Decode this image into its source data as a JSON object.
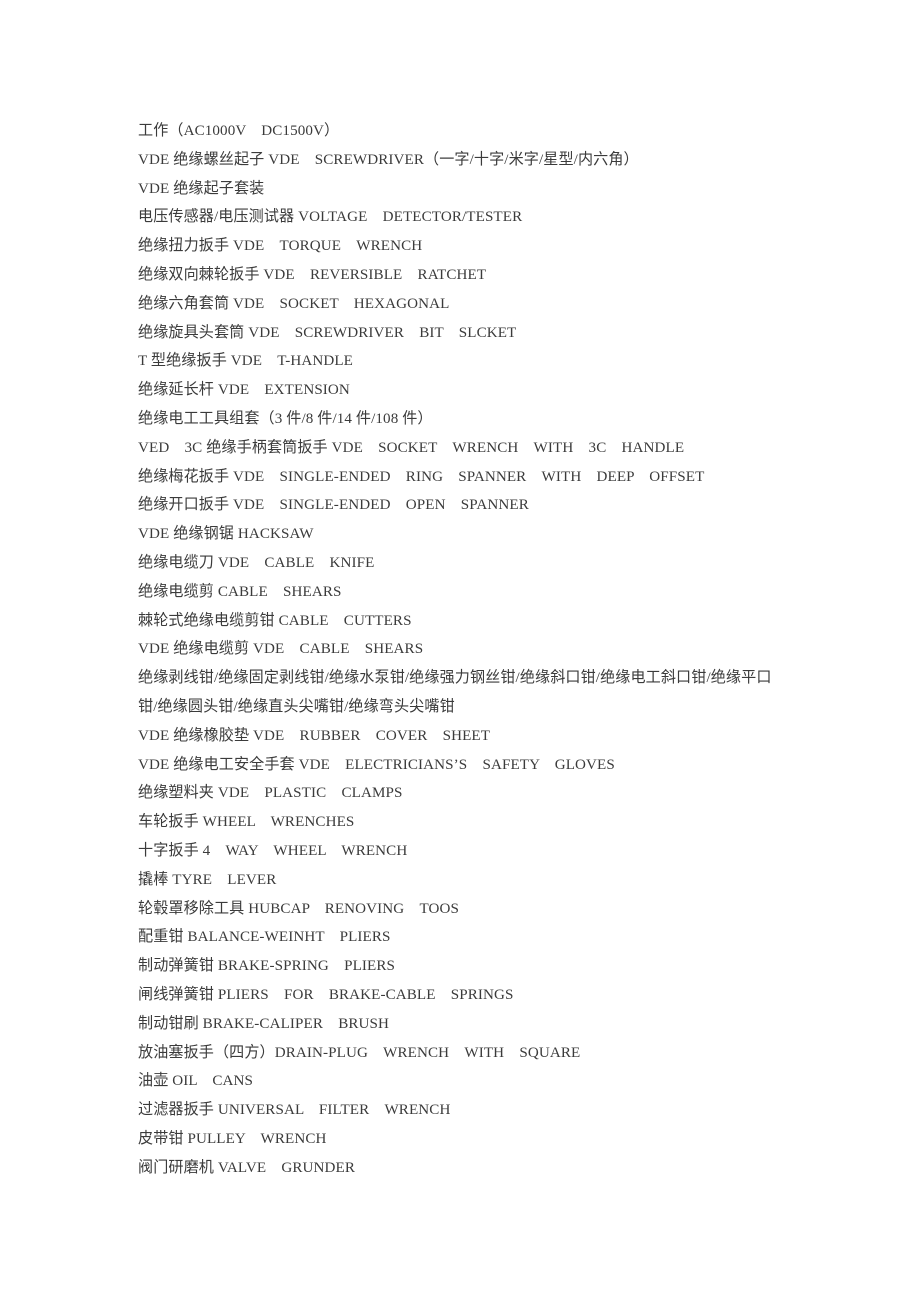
{
  "document": {
    "page_background": "#ffffff",
    "text_color": "#3b3b3b",
    "lines": [
      {
        "id": "line-1",
        "text": "工作（AC1000V　DC1500V）"
      },
      {
        "id": "line-2",
        "text": "VDE 绝缘螺丝起子 VDE　SCREWDRIVER（一字/十字/米字/星型/内六角）"
      },
      {
        "id": "line-3",
        "text": "VDE 绝缘起子套装"
      },
      {
        "id": "line-4",
        "text": "电压传感器/电压测试器 VOLTAGE　DETECTOR/TESTER"
      },
      {
        "id": "line-5",
        "text": "绝缘扭力扳手 VDE　TORQUE　WRENCH"
      },
      {
        "id": "line-6",
        "text": "绝缘双向棘轮扳手 VDE　REVERSIBLE　RATCHET"
      },
      {
        "id": "line-7",
        "text": "绝缘六角套筒 VDE　SOCKET　HEXAGONAL"
      },
      {
        "id": "line-8",
        "text": "绝缘旋具头套筒 VDE　SCREWDRIVER　BIT　SLCKET"
      },
      {
        "id": "line-9",
        "text": "T 型绝缘扳手 VDE　T-HANDLE"
      },
      {
        "id": "line-10",
        "text": "绝缘延长杆 VDE　EXTENSION"
      },
      {
        "id": "line-11",
        "text": "绝缘电工工具组套（3 件/8 件/14 件/108 件）"
      },
      {
        "id": "line-12",
        "text": "VED　3C 绝缘手柄套筒扳手 VDE　SOCKET　WRENCH　WITH　3C　HANDLE"
      },
      {
        "id": "line-13",
        "text": "绝缘梅花扳手 VDE　SINGLE-ENDED　RING　SPANNER　WITH　DEEP　OFFSET"
      },
      {
        "id": "line-14",
        "text": "绝缘开口扳手 VDE　SINGLE-ENDED　OPEN　SPANNER"
      },
      {
        "id": "line-15",
        "text": "VDE 绝缘钢锯 HACKSAW"
      },
      {
        "id": "line-16",
        "text": "绝缘电缆刀 VDE　CABLE　KNIFE"
      },
      {
        "id": "line-17",
        "text": "绝缘电缆剪 CABLE　SHEARS"
      },
      {
        "id": "line-18",
        "text": "棘轮式绝缘电缆剪钳 CABLE　CUTTERS"
      },
      {
        "id": "line-19",
        "text": "VDE 绝缘电缆剪 VDE　CABLE　SHEARS"
      },
      {
        "id": "line-20",
        "text": "绝缘剥线钳/绝缘固定剥线钳/绝缘水泵钳/绝缘强力钢丝钳/绝缘斜口钳/绝缘电工斜口钳/绝缘平口钳/绝缘圆头钳/绝缘直头尖嘴钳/绝缘弯头尖嘴钳",
        "wrap": true
      },
      {
        "id": "line-21",
        "text": "VDE 绝缘橡胶垫 VDE　RUBBER　COVER　SHEET"
      },
      {
        "id": "line-22",
        "text": "VDE 绝缘电工安全手套 VDE　ELECTRICIANS’S　SAFETY　GLOVES"
      },
      {
        "id": "line-23",
        "text": "绝缘塑料夹 VDE　PLASTIC　CLAMPS"
      },
      {
        "id": "line-24",
        "text": "车轮扳手 WHEEL　WRENCHES"
      },
      {
        "id": "line-25",
        "text": "十字扳手 4　WAY　WHEEL　WRENCH"
      },
      {
        "id": "line-26",
        "text": "撬棒 TYRE　LEVER"
      },
      {
        "id": "line-27",
        "text": "轮毂罩移除工具 HUBCAP　RENOVING　TOOS"
      },
      {
        "id": "line-28",
        "text": "配重钳 BALANCE-WEINHT　PLIERS"
      },
      {
        "id": "line-29",
        "text": "制动弹簧钳 BRAKE-SPRING　PLIERS"
      },
      {
        "id": "line-30",
        "text": "闸线弹簧钳 PLIERS　FOR　BRAKE-CABLE　SPRINGS"
      },
      {
        "id": "line-31",
        "text": "制动钳刷 BRAKE-CALIPER　BRUSH"
      },
      {
        "id": "line-32",
        "text": "放油塞扳手（四方）DRAIN-PLUG　WRENCH　WITH　SQUARE"
      },
      {
        "id": "line-33",
        "text": "油壶 OIL　CANS"
      },
      {
        "id": "line-34",
        "text": "过滤器扳手 UNIVERSAL　FILTER　WRENCH"
      },
      {
        "id": "line-35",
        "text": "皮带钳 PULLEY　WRENCH"
      },
      {
        "id": "line-36",
        "text": "阀门研磨机 VALVE　GRUNDER"
      }
    ]
  }
}
